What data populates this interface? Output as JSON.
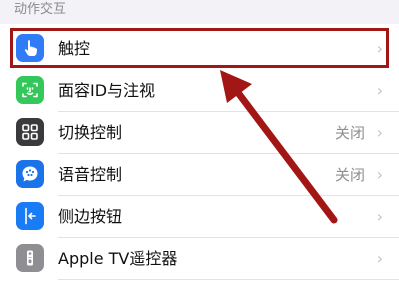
{
  "section_header": "动作交互",
  "rows": [
    {
      "label": "触控",
      "value": "",
      "icon": "hand-point-icon",
      "color": "#2f7cf6"
    },
    {
      "label": "面容ID与注视",
      "value": "",
      "icon": "face-id-icon",
      "color": "#34c759"
    },
    {
      "label": "切换控制",
      "value": "关闭",
      "icon": "grid-icon",
      "color": "#3a3a3c"
    },
    {
      "label": "语音控制",
      "value": "关闭",
      "icon": "voice-control-icon",
      "color": "#1a73e8"
    },
    {
      "label": "侧边按钮",
      "value": "",
      "icon": "side-button-icon",
      "color": "#1a7cf5"
    },
    {
      "label": "Apple TV遥控器",
      "value": "",
      "icon": "remote-icon",
      "color": "#8e8e93"
    }
  ],
  "highlight_color": "#a31616"
}
